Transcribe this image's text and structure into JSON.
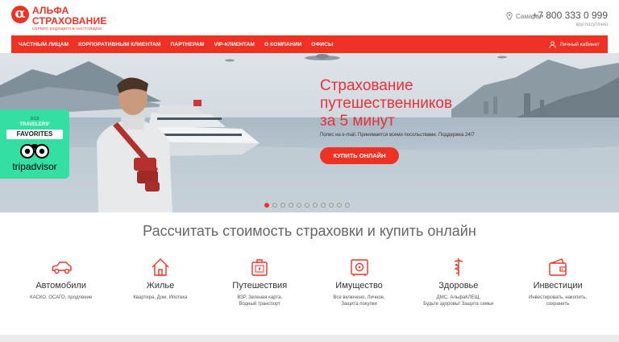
{
  "brand": {
    "line1": "АЛЬФА",
    "line2": "СТРАХОВАНИЕ",
    "tagline": "СЕРВИС БУДУЩЕГО В НАСТОЯЩЕМ"
  },
  "header": {
    "city": "Самара",
    "phone": "+7 800 333 0 999",
    "phone_sub": "круглосуточно"
  },
  "nav": {
    "items": [
      "ЧАСТНЫМ ЛИЦАМ",
      "КОРПОРАТИВНЫМ КЛИЕНТАМ",
      "ПАРТНЕРАМ",
      "VIP-КЛИЕНТАМ",
      "О КОМПАНИИ",
      "ОФИСЫ"
    ],
    "cabinet": "Личный кабинет"
  },
  "hero": {
    "title_lines": [
      "Страхование",
      "путешественников",
      "за 5 минут"
    ],
    "subtitle": "Полис на e-mail. Принимается всеми посольствами. Поддержка 24/7",
    "button": "КУПИТЬ ОНЛАЙН",
    "slides_total": 11,
    "active_slide": 1
  },
  "tripadvisor": {
    "year": "2018",
    "line1": "TRAVELERS'",
    "line2": "FAVORITES",
    "brand": "tripadvisor"
  },
  "calc": {
    "title": "Рассчитать стоимость страховки и купить онлайн"
  },
  "products": [
    {
      "icon": "car-icon",
      "name": "Автомобили",
      "desc": [
        "КАСКО, ОСАГО, продление"
      ]
    },
    {
      "icon": "house-icon",
      "name": "Жилье",
      "desc": [
        "Квартира, Дом, Ипотека"
      ]
    },
    {
      "icon": "suitcase-icon",
      "name": "Путешествия",
      "desc": [
        "ВЗР, Зеленая карта,",
        "Водный транспорт"
      ]
    },
    {
      "icon": "safe-icon",
      "name": "Имущество",
      "desc": [
        "Все включено, Личное,",
        "Защита покупки"
      ]
    },
    {
      "icon": "caduceus-icon",
      "name": "Здоровье",
      "desc": [
        "ДМС, АльфаКЛЕЩ,",
        "Будьте здоровы! Защита семьи"
      ]
    },
    {
      "icon": "wallet-icon",
      "name": "Инвестиции",
      "desc": [
        "Инвестировать, накопить,",
        "сохранить"
      ]
    }
  ],
  "colors": {
    "accent": "#ef3124",
    "tripadvisor": "#34e0a1"
  }
}
